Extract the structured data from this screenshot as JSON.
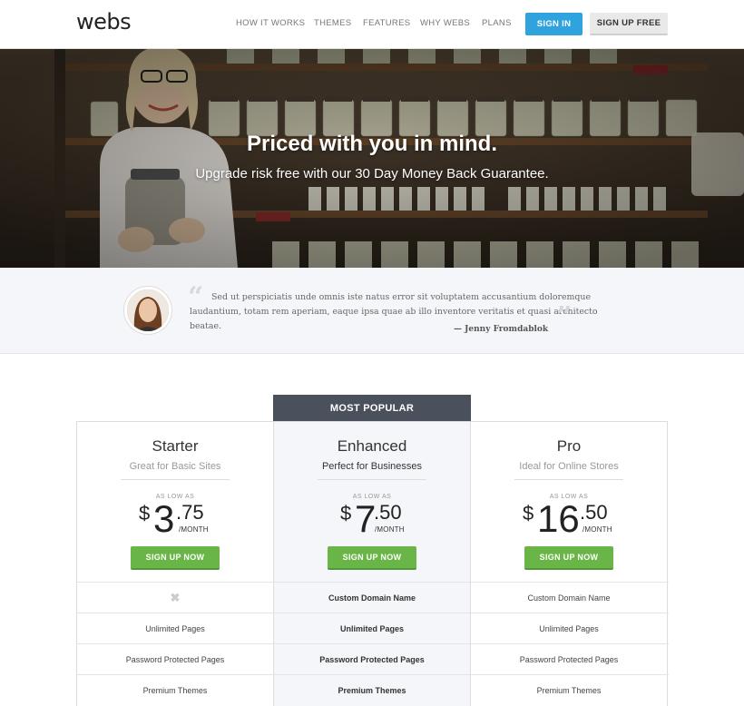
{
  "header": {
    "logo": "webs",
    "nav": [
      "HOW IT WORKS",
      "THEMES",
      "FEATURES",
      "WHY WEBS",
      "PLANS"
    ],
    "signin_label": "SIGN IN",
    "signup_label": "SIGN UP FREE"
  },
  "hero": {
    "title": "Priced with you in mind.",
    "subtitle": "Upgrade risk free with our 30 Day Money Back Guarantee."
  },
  "testimonial": {
    "quote": "Sed ut perspiciatis unde omnis iste natus error sit voluptatem accusantium doloremque laudantium, totam rem aperiam, eaque ipsa quae ab illo inventore veritatis et quasi architecto beatae.",
    "author": "— Jenny Fromdablok"
  },
  "pricing": {
    "popular_label": "MOST POPULAR",
    "plans": [
      {
        "name": "Starter",
        "desc": "Great for Basic Sites",
        "as_low_as": "AS LOW AS",
        "currency": "$",
        "dollars": "3",
        "cents": ".75",
        "period": "/MONTH",
        "cta": "SIGN UP NOW"
      },
      {
        "name": "Enhanced",
        "desc": "Perfect for Businesses",
        "as_low_as": "AS LOW AS",
        "currency": "$",
        "dollars": "7",
        "cents": ".50",
        "period": "/MONTH",
        "cta": "SIGN UP NOW"
      },
      {
        "name": "Pro",
        "desc": "Ideal for Online Stores",
        "as_low_as": "AS LOW AS",
        "currency": "$",
        "dollars": "16",
        "cents": ".50",
        "period": "/MONTH",
        "cta": "SIGN UP NOW"
      }
    ],
    "features": [
      [
        "",
        "Custom Domain Name",
        "Custom Domain Name"
      ],
      [
        "Unlimited Pages",
        "Unlimited Pages",
        "Unlimited Pages"
      ],
      [
        "Password Protected Pages",
        "Password Protected Pages",
        "Password Protected Pages"
      ],
      [
        "Premium Themes",
        "Premium Themes",
        "Premium Themes"
      ]
    ],
    "feature_not_included_icon": "x-icon"
  },
  "colors": {
    "signin_blue": "#2ea3dd",
    "cta_green": "#6ab547",
    "popular_dark": "#4a505c"
  }
}
